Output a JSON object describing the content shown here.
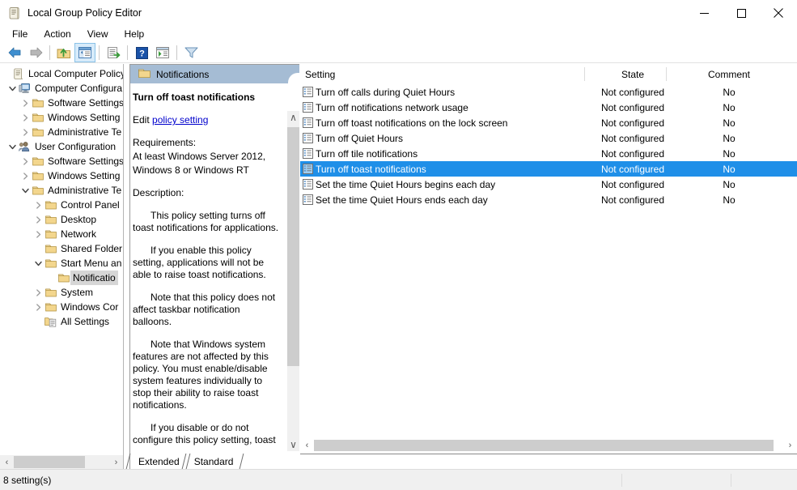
{
  "window": {
    "title": "Local Group Policy Editor",
    "icon": "policy-editor-icon",
    "minimize_label": "–",
    "maximize_label": "□",
    "close_label": "✕"
  },
  "menubar": {
    "items": [
      {
        "label": "File"
      },
      {
        "label": "Action"
      },
      {
        "label": "View"
      },
      {
        "label": "Help"
      }
    ]
  },
  "toolbar": {
    "buttons": [
      {
        "name": "back-icon",
        "tooltip": "Back"
      },
      {
        "name": "forward-icon",
        "tooltip": "Forward"
      },
      {
        "name": "up-folder-icon",
        "tooltip": "Up One Level"
      },
      {
        "name": "show-hide-tree-icon",
        "tooltip": "Show/Hide Console Tree",
        "selected": true
      },
      {
        "name": "export-list-icon",
        "tooltip": "Export List"
      },
      {
        "name": "help-icon",
        "tooltip": "Help"
      },
      {
        "name": "show-hide-action-pane-icon",
        "tooltip": "Show/Hide Action Pane"
      },
      {
        "name": "filter-icon",
        "tooltip": "Filter"
      }
    ]
  },
  "tree": {
    "root_label": "Local Computer Policy",
    "items": [
      {
        "label": "Local Computer Policy",
        "depth": 0,
        "twisty": "none",
        "icon": "policy-icon"
      },
      {
        "label": "Computer Configura",
        "depth": 1,
        "twisty": "expanded",
        "icon": "computer-icon"
      },
      {
        "label": "Software Settings",
        "depth": 2,
        "twisty": "collapsed",
        "icon": "folder-icon"
      },
      {
        "label": "Windows Setting",
        "depth": 2,
        "twisty": "collapsed",
        "icon": "folder-icon"
      },
      {
        "label": "Administrative Te",
        "depth": 2,
        "twisty": "collapsed",
        "icon": "folder-icon"
      },
      {
        "label": "User Configuration",
        "depth": 1,
        "twisty": "expanded",
        "icon": "user-icon"
      },
      {
        "label": "Software Settings",
        "depth": 2,
        "twisty": "collapsed",
        "icon": "folder-icon"
      },
      {
        "label": "Windows Setting",
        "depth": 2,
        "twisty": "collapsed",
        "icon": "folder-icon"
      },
      {
        "label": "Administrative Te",
        "depth": 2,
        "twisty": "expanded",
        "icon": "folder-icon"
      },
      {
        "label": "Control Panel",
        "depth": 3,
        "twisty": "collapsed",
        "icon": "folder-icon"
      },
      {
        "label": "Desktop",
        "depth": 3,
        "twisty": "collapsed",
        "icon": "folder-icon"
      },
      {
        "label": "Network",
        "depth": 3,
        "twisty": "collapsed",
        "icon": "folder-icon"
      },
      {
        "label": "Shared Folder",
        "depth": 3,
        "twisty": "none",
        "icon": "folder-icon"
      },
      {
        "label": "Start Menu an",
        "depth": 3,
        "twisty": "expanded",
        "icon": "folder-icon"
      },
      {
        "label": "Notificatio",
        "depth": 4,
        "twisty": "none",
        "icon": "folder-icon",
        "selected": true
      },
      {
        "label": "System",
        "depth": 3,
        "twisty": "collapsed",
        "icon": "folder-icon"
      },
      {
        "label": "Windows Cor",
        "depth": 3,
        "twisty": "collapsed",
        "icon": "folder-icon"
      },
      {
        "label": "All Settings",
        "depth": 3,
        "twisty": "none",
        "icon": "all-settings-icon"
      }
    ],
    "hscroll": {
      "left_arrow": "‹",
      "right_arrow": "›"
    }
  },
  "description": {
    "header_title": "Notifications",
    "header_icon": "folder-icon",
    "policy_title": "Turn off toast notifications",
    "edit_prefix": "Edit ",
    "edit_link": "policy setting",
    "requirements_label": "Requirements:",
    "requirements_text_1": "At least Windows Server 2012,",
    "requirements_text_2": "Windows 8 or Windows RT",
    "description_label": "Description:",
    "paragraphs": [
      "This policy setting turns off toast notifications for applications.",
      "If you enable this policy setting, applications will not be able to raise toast notifications.",
      "Note that this policy does not affect taskbar notification balloons.",
      "Note that Windows system features are not affected by this policy.  You must enable/disable system features individually to stop their ability to raise toast notifications.",
      "If you disable or do not configure this policy setting, toast"
    ],
    "scrollbar": {
      "up_arrow": "∧",
      "down_arrow": "∨"
    },
    "tabs": [
      {
        "label": "Extended",
        "active": true
      },
      {
        "label": "Standard",
        "active": false
      }
    ]
  },
  "list": {
    "columns": [
      {
        "label": "Setting",
        "key": "setting"
      },
      {
        "label": "State",
        "key": "state"
      },
      {
        "label": "Comment",
        "key": "comment"
      }
    ],
    "rows": [
      {
        "setting": "Turn off calls during Quiet Hours",
        "state": "Not configured",
        "comment": "No",
        "selected": false
      },
      {
        "setting": "Turn off notifications network usage",
        "state": "Not configured",
        "comment": "No",
        "selected": false
      },
      {
        "setting": "Turn off toast notifications on the lock screen",
        "state": "Not configured",
        "comment": "No",
        "selected": false
      },
      {
        "setting": "Turn off Quiet Hours",
        "state": "Not configured",
        "comment": "No",
        "selected": false
      },
      {
        "setting": "Turn off tile notifications",
        "state": "Not configured",
        "comment": "No",
        "selected": false
      },
      {
        "setting": "Turn off toast notifications",
        "state": "Not configured",
        "comment": "No",
        "selected": true
      },
      {
        "setting": "Set the time Quiet Hours begins each day",
        "state": "Not configured",
        "comment": "No",
        "selected": false
      },
      {
        "setting": "Set the time Quiet Hours ends each day",
        "state": "Not configured",
        "comment": "No",
        "selected": false
      }
    ],
    "hscroll": {
      "left_arrow": "‹",
      "right_arrow": "›"
    }
  },
  "statusbar": {
    "text": "8 setting(s)"
  },
  "colors": {
    "selection_blue": "#1f8fe8",
    "header_blue": "#a5bcd4",
    "tree_selection_gray": "#d6d6d6",
    "link_blue": "#0000cc",
    "scrollbar_thumb": "#cdcdcd",
    "statusbar_bg": "#f0f0f0"
  }
}
